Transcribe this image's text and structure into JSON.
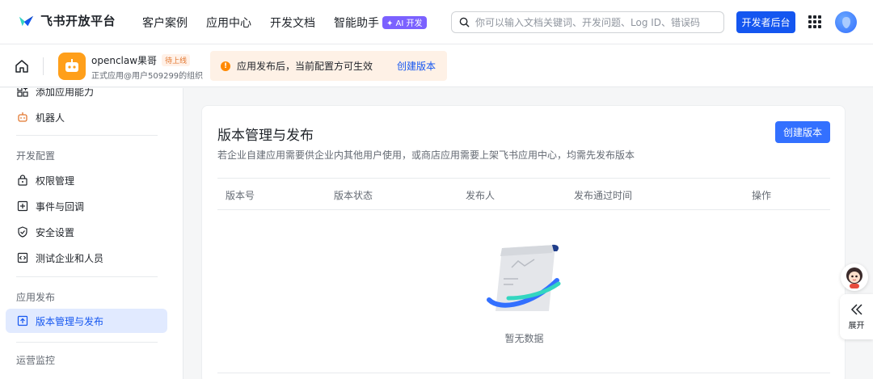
{
  "brand": {
    "name": "飞书开放平台",
    "accent": "#1456f0"
  },
  "nav": {
    "links": [
      "客户案例",
      "应用中心",
      "开发文档",
      "智能助手"
    ],
    "ai_badge": "✦ AI 开发"
  },
  "search": {
    "placeholder": "你可以输入文档关键词、开发问题、Log ID、错误码",
    "icon": "search-icon"
  },
  "dev_console_button": "开发者后台",
  "app": {
    "name": "openclaw果哥",
    "status_badge": "待上线",
    "subtitle": "正式应用@用户509299的组织"
  },
  "notice": {
    "text": "应用发布后，当前配置方可生效",
    "link": "创建版本",
    "color": "#ff8800"
  },
  "sidebar": {
    "items_top": [
      {
        "label": "添加应用能力",
        "icon": "add-capability-icon"
      },
      {
        "label": "机器人",
        "icon": "robot-icon"
      }
    ],
    "group_dev": "开发配置",
    "dev_items": [
      {
        "label": "权限管理",
        "icon": "permission-icon"
      },
      {
        "label": "事件与回调",
        "icon": "event-icon"
      },
      {
        "label": "安全设置",
        "icon": "shield-icon"
      },
      {
        "label": "测试企业和人员",
        "icon": "code-icon"
      }
    ],
    "group_publish": "应用发布",
    "publish_items": [
      {
        "label": "版本管理与发布",
        "icon": "upload-icon",
        "active": true
      }
    ],
    "group_monitor": "运营监控"
  },
  "main": {
    "title": "版本管理与发布",
    "description": "若企业自建应用需要供企业内其他用户使用，或商店应用需要上架飞书应用中心，均需先发布版本",
    "create_button": "创建版本",
    "columns": [
      "版本号",
      "版本状态",
      "发布人",
      "发布通过时间",
      "操作"
    ],
    "empty_text": "暂无数据"
  },
  "floating": {
    "expand_label": "展开"
  }
}
